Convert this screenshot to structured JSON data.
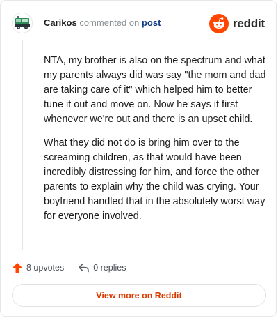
{
  "comment": {
    "username": "Carikos",
    "action_text": "commented on",
    "post_link_label": "post",
    "paragraphs": [
      "NTA, my brother is also on the spectrum and what my parents always did was say \"the mom and dad are taking care of it\" which helped him to better tune it out and move on. Now he says it first whenever we're out and there is an upset child.",
      "What they did not do is bring him over to the screaming children, as that would have been incredibly distressing for him, and force the other parents to explain why the child was crying. Your boyfriend handled that in the absolutely worst way for everyone involved."
    ],
    "upvotes_label": "8 upvotes",
    "replies_label": "0 replies"
  },
  "brand": {
    "name": "reddit",
    "accent": "#ff4500",
    "logo_icon": "reddit-snoo-icon"
  },
  "avatar_icon": "truck-avatar-icon",
  "icons": {
    "upvote": "upvote-arrow-icon",
    "reply": "reply-arrow-icon"
  },
  "footer": {
    "view_button_label": "View more on Reddit",
    "view_button_color": "#d93a00"
  }
}
